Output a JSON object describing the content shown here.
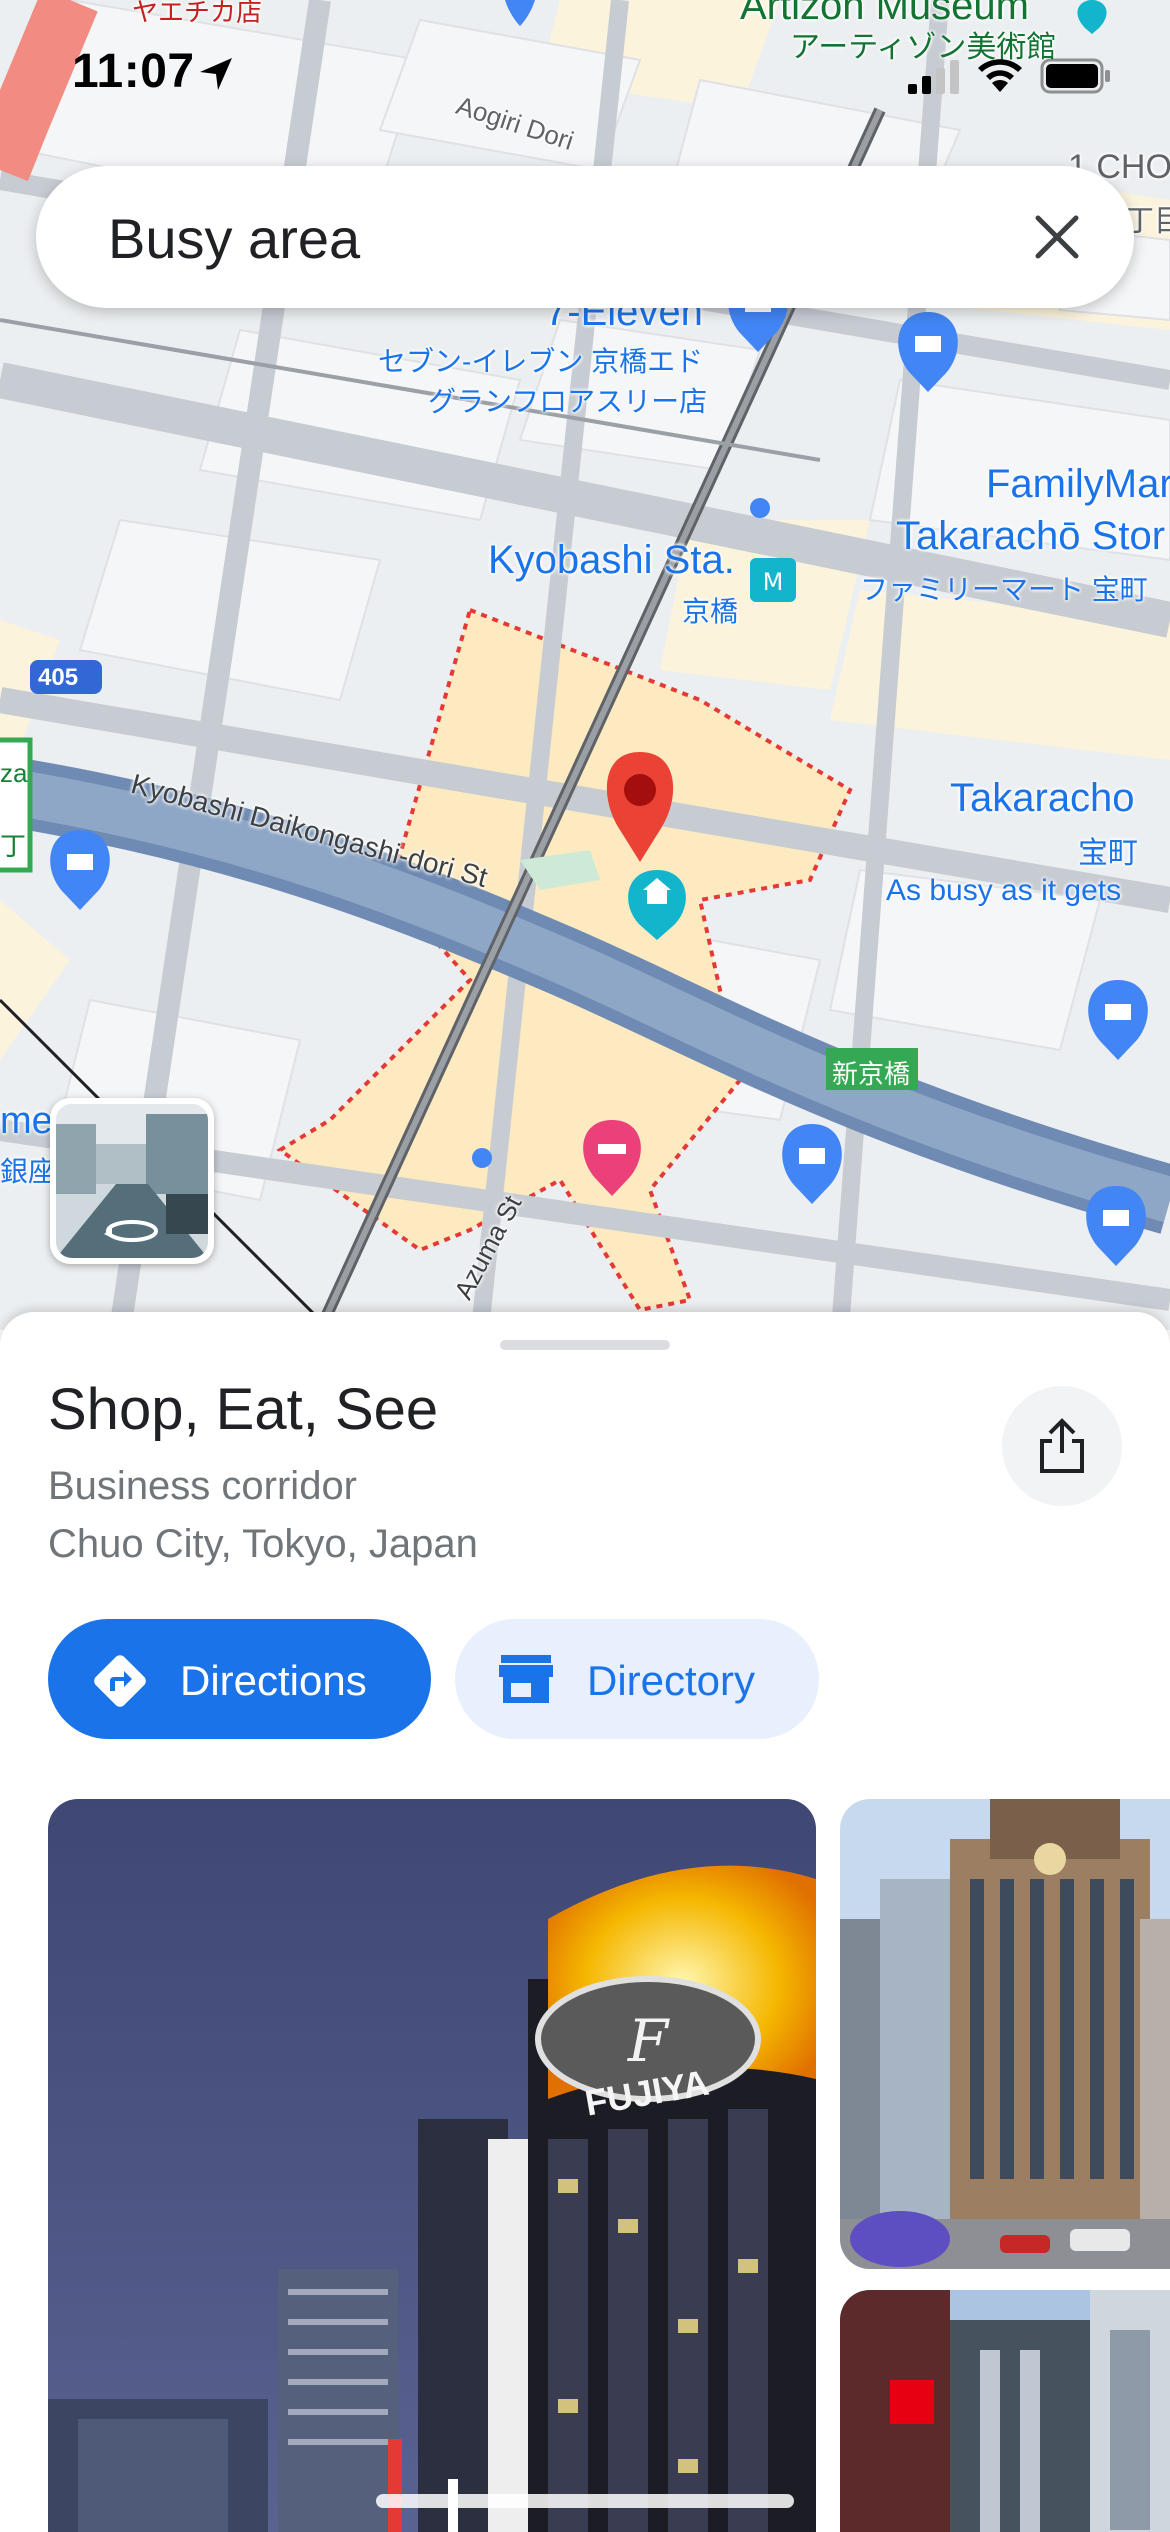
{
  "status_bar": {
    "time": "11:07",
    "location_icon": "location-arrow-icon",
    "signal_icon": "cellular-signal-icon",
    "wifi_icon": "wifi-icon",
    "battery_icon": "battery-icon"
  },
  "search": {
    "query": "Busy area",
    "close_icon": "close-icon"
  },
  "map": {
    "labels": {
      "yaesu_store": "ヤエチカ店",
      "artizon": "Artizon Museum",
      "artizon_jp": "アーティゾン美術館",
      "aogiri": "Aogiri Dori",
      "top_right_1": "1 CHO",
      "top_right_2": "丁目",
      "seven_eleven": "7-Eleven",
      "seven_eleven_jp1": "セブン-イレブン 京橋エド",
      "seven_eleven_jp2": "グランフロアスリー店",
      "familymart": "FamilyMar",
      "takaracho_store": "Takarachō Stor",
      "familymart_jp": "ファミリーマート 宝町",
      "kyobashi_sta": "Kyobashi Sta.",
      "kyobashi_jp": "京橋",
      "route_405": "405",
      "takaracho": "Takaracho",
      "takaracho_jp": "宝町",
      "busy_note": "As busy as it gets",
      "kyobashi_daikongashi": "Kyobashi Daikongashi-dori St",
      "shinkyobashi": "新京橋",
      "azuma": "Azuma St",
      "left_edge_1": "me",
      "left_edge_2": "銀座",
      "left_sign_1": "za",
      "left_sign_2": "丁"
    }
  },
  "place": {
    "title": "Shop, Eat, See",
    "category": "Business corridor",
    "address": "Chuo City, Tokyo, Japan",
    "share_icon": "share-icon"
  },
  "actions": {
    "directions_label": "Directions",
    "directory_label": "Directory"
  },
  "photos": {
    "main_sign": "FUJIYA"
  },
  "colors": {
    "accent": "#1a73e8",
    "pin": "#ea4335",
    "area_fill": "#feefc3",
    "area_border": "#e53935",
    "water": "#7b95b5"
  }
}
